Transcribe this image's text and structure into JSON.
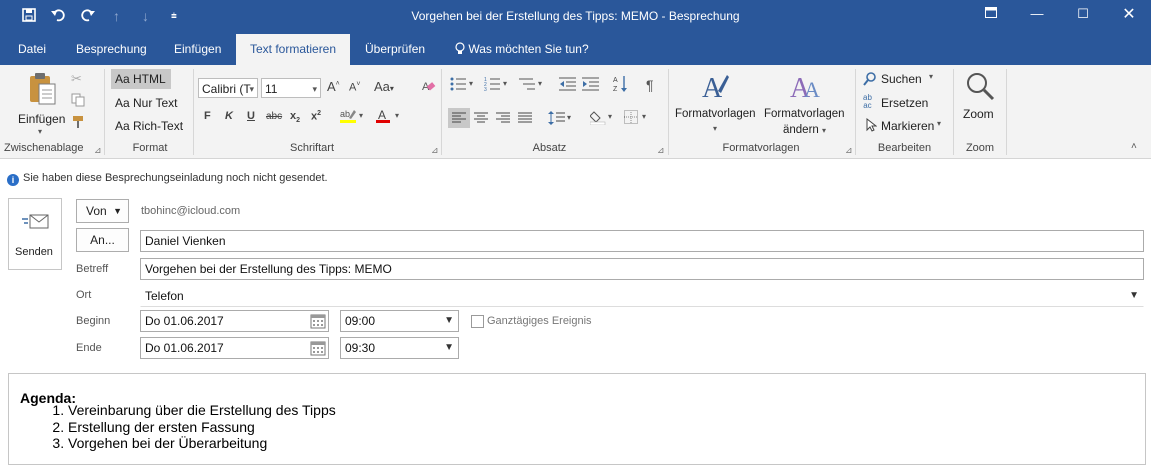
{
  "window": {
    "title": "Vorgehen bei der Erstellung des Tipps: MEMO  -  Besprechung",
    "qat_icons": [
      "save-icon",
      "undo-icon",
      "redo-icon",
      "up-arrow-icon",
      "down-arrow-icon",
      "customize-icon"
    ]
  },
  "tabs": [
    "Datei",
    "Besprechung",
    "Einfügen",
    "Text formatieren",
    "Überprüfen"
  ],
  "tell_me": "Was möchten Sie tun?",
  "ribbon": {
    "clipboard": {
      "paste_label": "Einfügen",
      "group": "Zwischenablage"
    },
    "format": {
      "html": "Aa HTML",
      "plain": "Aa Nur Text",
      "rich": "Aa Rich-Text",
      "group": "Format"
    },
    "font": {
      "family": "Calibri (T",
      "size": "11",
      "group": "Schriftart"
    },
    "paragraph": {
      "group": "Absatz"
    },
    "styles": {
      "style_sets": "Formatvorlagen",
      "change_styles_1": "Formatvorlagen",
      "change_styles_2": "ändern",
      "group": "Formatvorlagen"
    },
    "editing": {
      "find": "Suchen",
      "replace": "Ersetzen",
      "select": "Markieren",
      "group": "Bearbeiten"
    },
    "zoom": {
      "label": "Zoom",
      "group": "Zoom"
    }
  },
  "info_message": "Sie haben diese Besprechungseinladung noch nicht gesendet.",
  "form": {
    "send_label": "Senden",
    "from_label": "Von",
    "from_value": "tbohinc@icloud.com",
    "to_label": "An...",
    "to_value": "Daniel Vienken",
    "subject_label": "Betreff",
    "subject_value": "Vorgehen bei der Erstellung des Tipps: MEMO",
    "location_label": "Ort",
    "location_value": "Telefon",
    "start_label": "Beginn",
    "start_date": "Do 01.06.2017",
    "start_time": "09:00",
    "end_label": "Ende",
    "end_date": "Do 01.06.2017",
    "end_time": "09:30",
    "allday_label": "Ganztägiges Ereignis"
  },
  "body": {
    "heading": "Agenda:",
    "items": [
      "Vereinbarung über die Erstellung des Tipps",
      "Erstellung der ersten Fassung",
      "Vorgehen bei der Überarbeitung"
    ]
  }
}
